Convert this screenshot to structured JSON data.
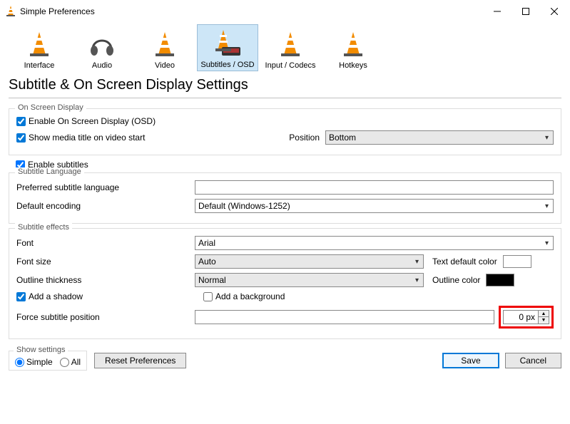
{
  "window": {
    "title": "Simple Preferences"
  },
  "toolbar": {
    "items": [
      {
        "label": "Interface"
      },
      {
        "label": "Audio"
      },
      {
        "label": "Video"
      },
      {
        "label": "Subtitles / OSD"
      },
      {
        "label": "Input / Codecs"
      },
      {
        "label": "Hotkeys"
      }
    ],
    "selected_index": 3
  },
  "page": {
    "title": "Subtitle & On Screen Display Settings"
  },
  "osd": {
    "group_title": "On Screen Display",
    "enable_osd_label": "Enable On Screen Display (OSD)",
    "enable_osd_checked": true,
    "show_title_label": "Show media title on video start",
    "show_title_checked": true,
    "position_label": "Position",
    "position_value": "Bottom"
  },
  "enable_subtitles": {
    "label": "Enable subtitles",
    "checked": true
  },
  "language": {
    "group_title": "Subtitle Language",
    "preferred_label": "Preferred subtitle language",
    "preferred_value": "",
    "default_encoding_label": "Default encoding",
    "default_encoding_value": "Default (Windows-1252)"
  },
  "effects": {
    "group_title": "Subtitle effects",
    "font_label": "Font",
    "font_value": "Arial",
    "font_size_label": "Font size",
    "font_size_value": "Auto",
    "text_default_color_label": "Text default color",
    "text_default_color": "#ffffff",
    "outline_thickness_label": "Outline thickness",
    "outline_thickness_value": "Normal",
    "outline_color_label": "Outline color",
    "outline_color": "#000000",
    "add_shadow_label": "Add a shadow",
    "add_shadow_checked": true,
    "add_background_label": "Add a background",
    "add_background_checked": false,
    "force_position_label": "Force subtitle position",
    "force_position_value": "0 px"
  },
  "bottom": {
    "show_settings_title": "Show settings",
    "simple_label": "Simple",
    "all_label": "All",
    "selected": "simple",
    "reset_label": "Reset Preferences",
    "save_label": "Save",
    "cancel_label": "Cancel"
  }
}
